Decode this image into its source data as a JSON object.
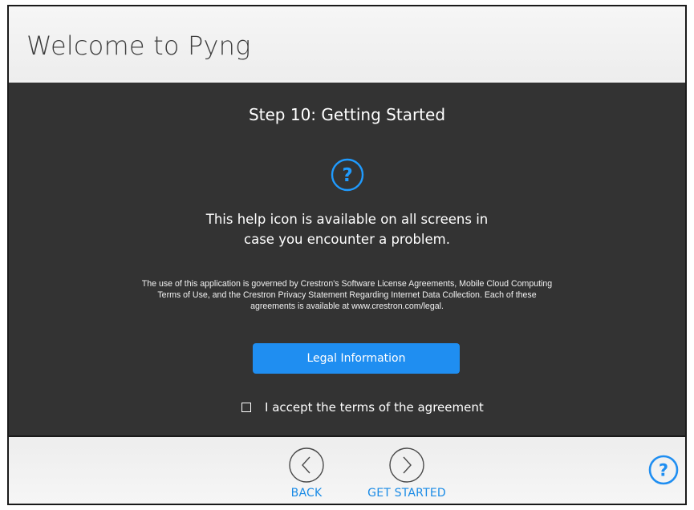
{
  "app": {
    "title": "Welcome to Pyng"
  },
  "step": {
    "title": "Step 10: Getting Started",
    "help_icon": "help-circle-icon",
    "help_line1": "This help icon is available on all screens in",
    "help_line2": "case you encounter a problem.",
    "legal_line1": "The use of this application is governed by Crestron's Software License Agreements, Mobile Cloud Computing",
    "legal_line2": "Terms of Use, and the Crestron Privacy Statement Regarding Internet Data Collection. Each of these",
    "legal_line3": "agreements is available at www.crestron.com/legal.",
    "legal_button_label": "Legal Information",
    "accept_label": "I accept the terms of the agreement",
    "accept_checked": false
  },
  "footer": {
    "back_label": "BACK",
    "back_icon": "chevron-left-circle-icon",
    "start_label": "GET STARTED",
    "start_icon": "chevron-right-circle-icon",
    "help_icon": "help-circle-icon"
  },
  "colors": {
    "accent": "#1f8ef1",
    "panel_bg": "#333333",
    "chrome_bg": "#f2f2f2"
  }
}
